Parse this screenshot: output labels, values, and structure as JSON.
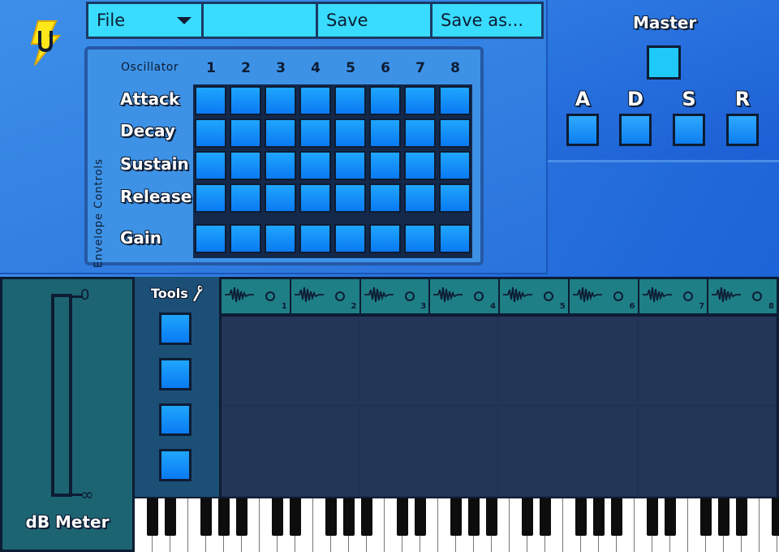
{
  "menu": {
    "file_label": "File",
    "blank_label": "",
    "save_label": "Save",
    "save_as_label": "Save as..."
  },
  "envelope": {
    "oscillator_label": "Oscillator",
    "side_label": "Envelope Controls",
    "columns": [
      "1",
      "2",
      "3",
      "4",
      "5",
      "6",
      "7",
      "8"
    ],
    "rows": [
      "Attack",
      "Decay",
      "Sustain",
      "Release"
    ],
    "gain_label": "Gain"
  },
  "master": {
    "title": "Master",
    "adsr": [
      "A",
      "D",
      "S",
      "R"
    ]
  },
  "meter": {
    "top_label": "0",
    "bottom_label": "∞",
    "title": "dB Meter"
  },
  "tools": {
    "label": "Tools"
  },
  "tracks": {
    "numbers": [
      "1",
      "2",
      "3",
      "4",
      "5",
      "6",
      "7",
      "8"
    ]
  },
  "colors": {
    "accent": "#39dcff",
    "knob": "#0a7af2",
    "outline": "#0d1c33",
    "track_header": "#1f7f86",
    "meter_panel": "#1d6472"
  }
}
